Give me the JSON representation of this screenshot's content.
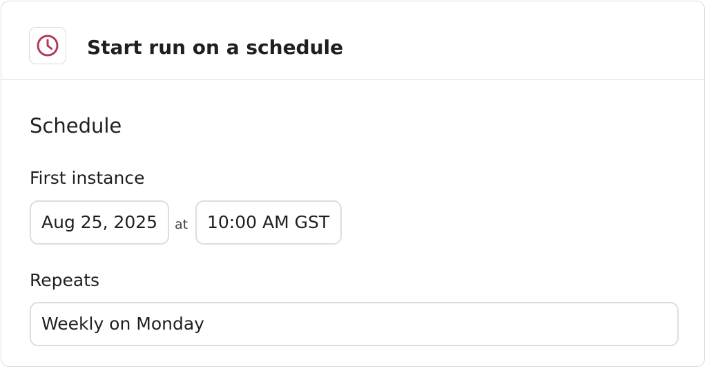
{
  "header": {
    "title": "Start run on a schedule",
    "icon": "clock-icon",
    "icon_color": "#b23a5a"
  },
  "schedule": {
    "section_title": "Schedule",
    "first_instance": {
      "label": "First instance",
      "date": "Aug 25, 2025",
      "at_label": "at",
      "time": "10:00 AM GST"
    },
    "repeats": {
      "label": "Repeats",
      "value": "Weekly on Monday"
    }
  }
}
